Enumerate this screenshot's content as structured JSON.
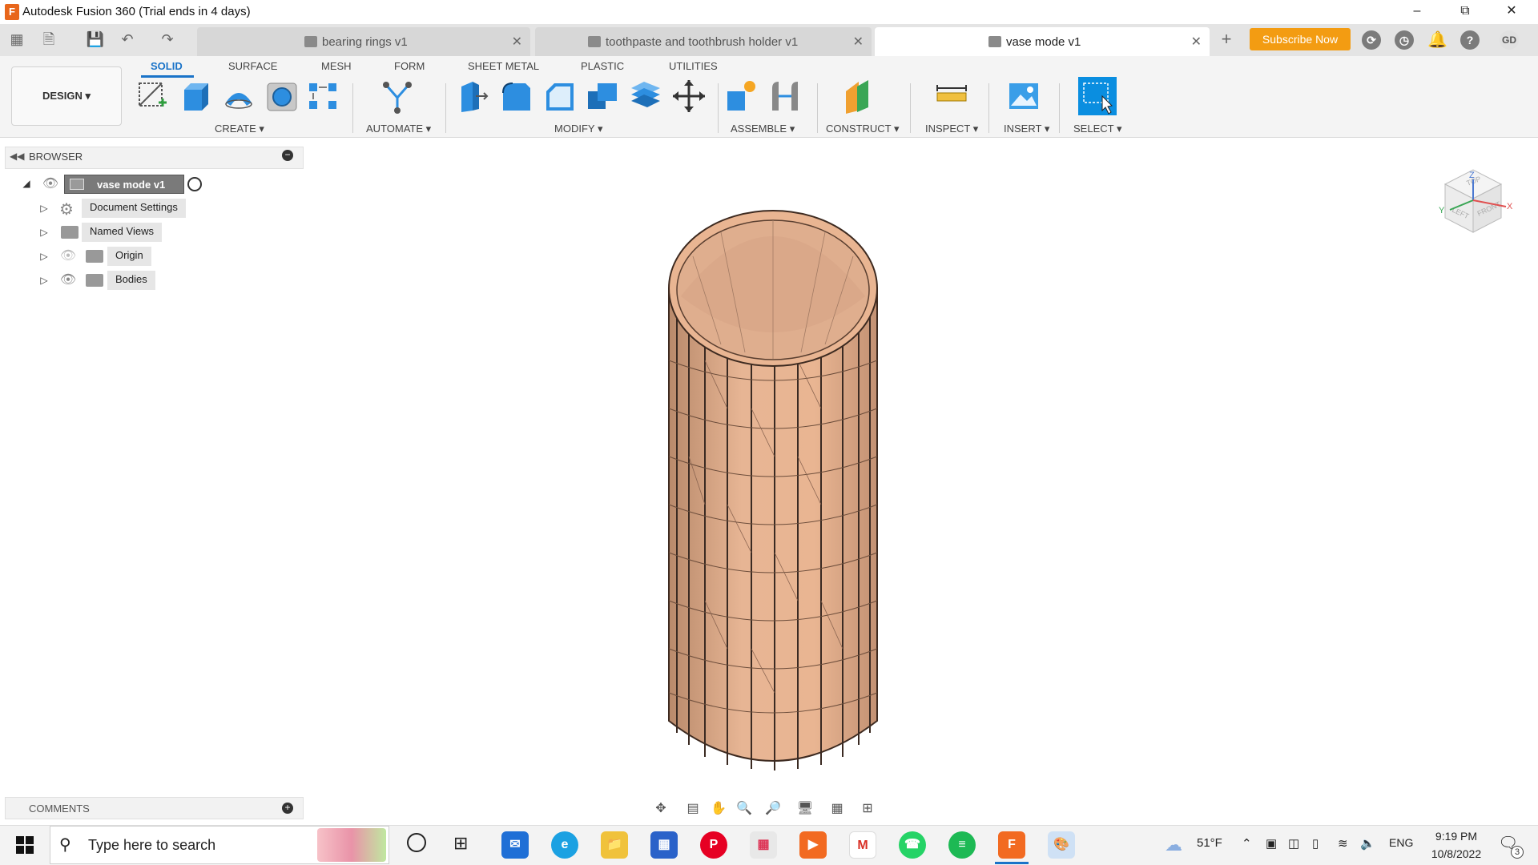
{
  "window": {
    "app_icon": "F",
    "title": "Autodesk Fusion 360 (Trial ends in 4 days)",
    "controls": [
      "minimize-icon",
      "restore-icon",
      "close-icon"
    ]
  },
  "tabs": [
    {
      "label": "bearing rings v1",
      "active": false
    },
    {
      "label": "toothpaste and toothbrush holder v1",
      "active": false
    },
    {
      "label": "vase mode v1",
      "active": true
    }
  ],
  "header": {
    "subscribe": "Subscribe Now",
    "user_initials": "GD"
  },
  "ribbon": {
    "workspace": "DESIGN",
    "tabs": [
      "SOLID",
      "SURFACE",
      "MESH",
      "FORM",
      "SHEET METAL",
      "PLASTIC",
      "UTILITIES"
    ],
    "active_tab": "SOLID",
    "groups": [
      "CREATE",
      "AUTOMATE",
      "MODIFY",
      "ASSEMBLE",
      "CONSTRUCT",
      "INSPECT",
      "INSERT",
      "SELECT"
    ]
  },
  "browser": {
    "title": "BROWSER",
    "root": "vase mode v1",
    "items": [
      "Document Settings",
      "Named Views",
      "Origin",
      "Bodies"
    ]
  },
  "comments": {
    "title": "COMMENTS"
  },
  "viewcube": {
    "faces": [
      "TOP",
      "LEFT",
      "FRONT"
    ],
    "axes": [
      "Y",
      "Z",
      "X"
    ]
  },
  "taskbar": {
    "search_placeholder": "Type here to search",
    "weather": "51°F",
    "language": "ENG",
    "time": "9:19 PM",
    "date": "10/8/2022",
    "notifications": "3"
  },
  "colors": {
    "accent": "#1a73c8",
    "subscribe": "#f39c12",
    "model": "#e9b592"
  }
}
